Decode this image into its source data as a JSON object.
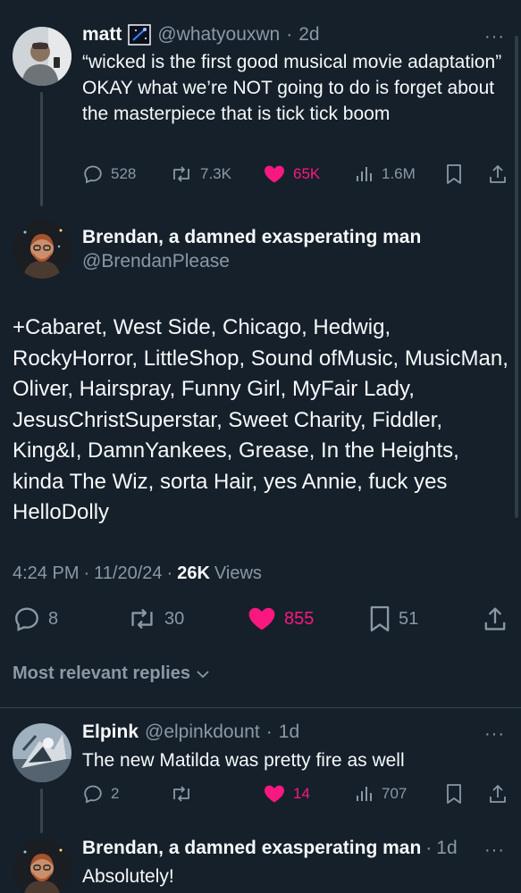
{
  "post1": {
    "display_name": "matt",
    "handle": "@whatyouxwn",
    "time": "2d",
    "text": "“wicked is the first good musical movie adaptation” OKAY what we’re NOT going to do is forget about the masterpiece that is tick tick boom",
    "replies": "528",
    "reposts": "7.3K",
    "likes": "65K",
    "views": "1.6M"
  },
  "main": {
    "display_name": "Brendan, a damned exasperating man",
    "handle": "@BrendanPlease",
    "text": "+Cabaret, West Side, Chicago, Hedwig, RockyHorror, LittleShop, Sound ofMusic, MusicMan, Oliver, Hairspray, Funny Girl, MyFair Lady, JesusChristSuperstar, Sweet Charity, Fiddler, King&I, DamnYankees, Grease, In the Heights, kinda The Wiz, sorta Hair, yes Annie, fuck yes HelloDolly",
    "time": "4:24 PM",
    "date": "11/20/24",
    "views_count": "26K",
    "views_label": "Views",
    "replies": "8",
    "reposts": "30",
    "likes": "855",
    "bookmarks": "51"
  },
  "sort_label": "Most relevant replies",
  "reply1": {
    "display_name": "Elpink",
    "handle": "@elpinkdount",
    "time": "1d",
    "text": "The new Matilda was pretty fire as well",
    "replies": "2",
    "reposts": "",
    "likes": "14",
    "views": "707"
  },
  "reply2": {
    "display_name": "Brendan, a damned exasperating man",
    "time": "1d",
    "text": "Absolutely!"
  },
  "separator": "·",
  "more_dots": "···",
  "colors": {
    "background": "#15202b",
    "like": "#f91880",
    "muted": "#8b98a5",
    "line": "#38444d"
  }
}
